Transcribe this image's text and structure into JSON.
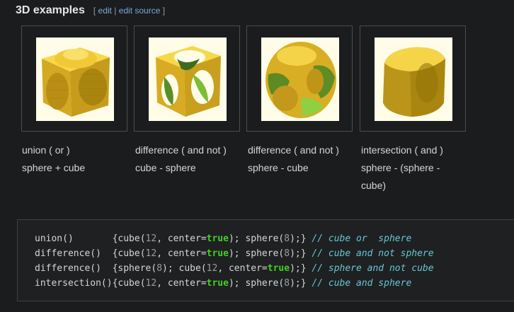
{
  "section": {
    "title": "3D examples",
    "edit_open": "[",
    "edit_label": "edit",
    "edit_sep": "|",
    "edit_source_label": "edit source",
    "edit_close": "]"
  },
  "examples": [
    {
      "op": "union ( or )",
      "formula": "sphere + cube"
    },
    {
      "op": "difference ( and not )",
      "formula": "cube - sphere"
    },
    {
      "op": "difference ( and not )",
      "formula": "sphere - cube"
    },
    {
      "op": "intersection ( and )",
      "formula": "sphere - (sphere - cube)"
    }
  ],
  "code": {
    "lines": [
      {
        "fn": "union()       ",
        "t1": "{cube(",
        "n1": "12",
        "t2": ", center=",
        "kw": "true",
        "t3": "); sphere(",
        "n2": "8",
        "t4": ");} ",
        "comment": "// cube or  sphere"
      },
      {
        "fn": "difference()  ",
        "t1": "{cube(",
        "n1": "12",
        "t2": ", center=",
        "kw": "true",
        "t3": "); sphere(",
        "n2": "8",
        "t4": ");} ",
        "comment": "// cube and not sphere"
      },
      {
        "fn": "difference()  ",
        "t1": "{sphere(",
        "n1": "8",
        "t2": "); cube(",
        "n2": "12",
        "t3": ", center=",
        "kw": "true",
        "t4": ");} ",
        "comment": "// sphere and not cube"
      },
      {
        "fn": "intersection()",
        "t1": "{cube(",
        "n1": "12",
        "t2": ", center=",
        "kw": "true",
        "t3": "); sphere(",
        "n2": "8",
        "t4": ");} ",
        "comment": "// cube and sphere"
      }
    ]
  },
  "colors": {
    "background": "#1b1c1e",
    "link": "#7fa8d8",
    "keyword": "#3fd11e",
    "comment": "#67c7d2",
    "render_yellow": "#e8c43a",
    "render_green": "#8cc63a",
    "render_bg": "#fffde8"
  }
}
